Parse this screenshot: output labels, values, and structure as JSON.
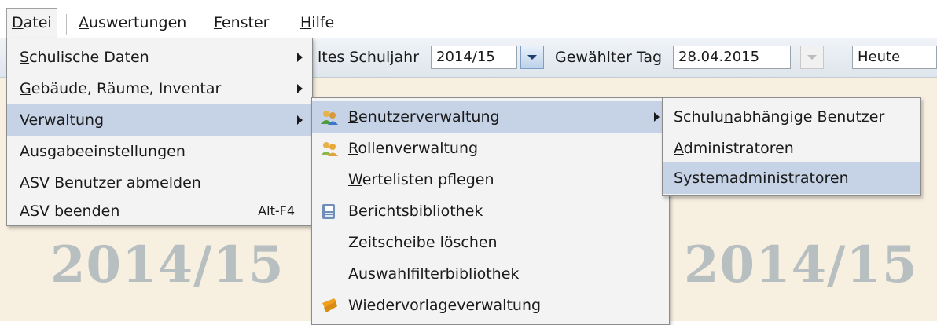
{
  "menubar": {
    "items": [
      {
        "pre": "",
        "mn": "D",
        "post": "atei"
      },
      {
        "pre": "",
        "mn": "A",
        "post": "uswertungen"
      },
      {
        "pre": "",
        "mn": "F",
        "post": "enster"
      },
      {
        "pre": "",
        "mn": "H",
        "post": "ilfe"
      }
    ]
  },
  "toolbar": {
    "schuljahr_label": "ltes Schuljahr",
    "schuljahr_value": "2014/15",
    "tag_label": "Gewählter Tag",
    "tag_value": "28.04.2015",
    "heute_value": "Heute"
  },
  "background": {
    "year_left": "2014/15",
    "year_right": "2014/15"
  },
  "datei_menu": {
    "items": [
      {
        "pre": "",
        "mn": "S",
        "post": "chulische Daten",
        "arrow": true
      },
      {
        "pre": "",
        "mn": "G",
        "post": "ebäude, Räume, Inventar",
        "arrow": true
      },
      {
        "pre": "",
        "mn": "V",
        "post": "erwaltung",
        "arrow": true
      },
      {
        "pre": "",
        "mn": "",
        "post": "Ausgabeeinstellungen"
      },
      {
        "pre": "",
        "mn": "",
        "post": "ASV Benutzer abmelden"
      },
      {
        "pre": "ASV ",
        "mn": "b",
        "post": "eenden",
        "shortcut": "Alt-F4"
      }
    ]
  },
  "verwaltung_menu": {
    "items": [
      {
        "pre": "",
        "mn": "B",
        "post": "enutzerverwaltung",
        "icon": "users-icon",
        "arrow": true
      },
      {
        "pre": "",
        "mn": "R",
        "post": "ollenverwaltung",
        "icon": "roles-icon"
      },
      {
        "pre": "",
        "mn": "W",
        "post": "ertelisten pflegen"
      },
      {
        "pre": "",
        "mn": "",
        "post": "Berichtsbibliothek",
        "icon": "report-library-icon"
      },
      {
        "pre": "",
        "mn": "",
        "post": "Zeitscheibe löschen"
      },
      {
        "pre": "",
        "mn": "",
        "post": "Auswahlfilterbibliothek"
      },
      {
        "pre": "",
        "mn": "",
        "post": "Wiedervorlageverwaltung",
        "icon": "resubmission-icon"
      }
    ]
  },
  "benutzer_menu": {
    "items": [
      {
        "pre": "Schulu",
        "mn": "n",
        "post": "abhängige Benutzer"
      },
      {
        "pre": "",
        "mn": "A",
        "post": "dministratoren"
      },
      {
        "pre": "",
        "mn": "S",
        "post": "ystemadministratoren"
      }
    ]
  },
  "colors": {
    "highlight": "#c6d3e6",
    "menu_bg": "#f3f3f3",
    "app_bg": "#f7efe0",
    "year_watermark": "#b7bfc0"
  }
}
